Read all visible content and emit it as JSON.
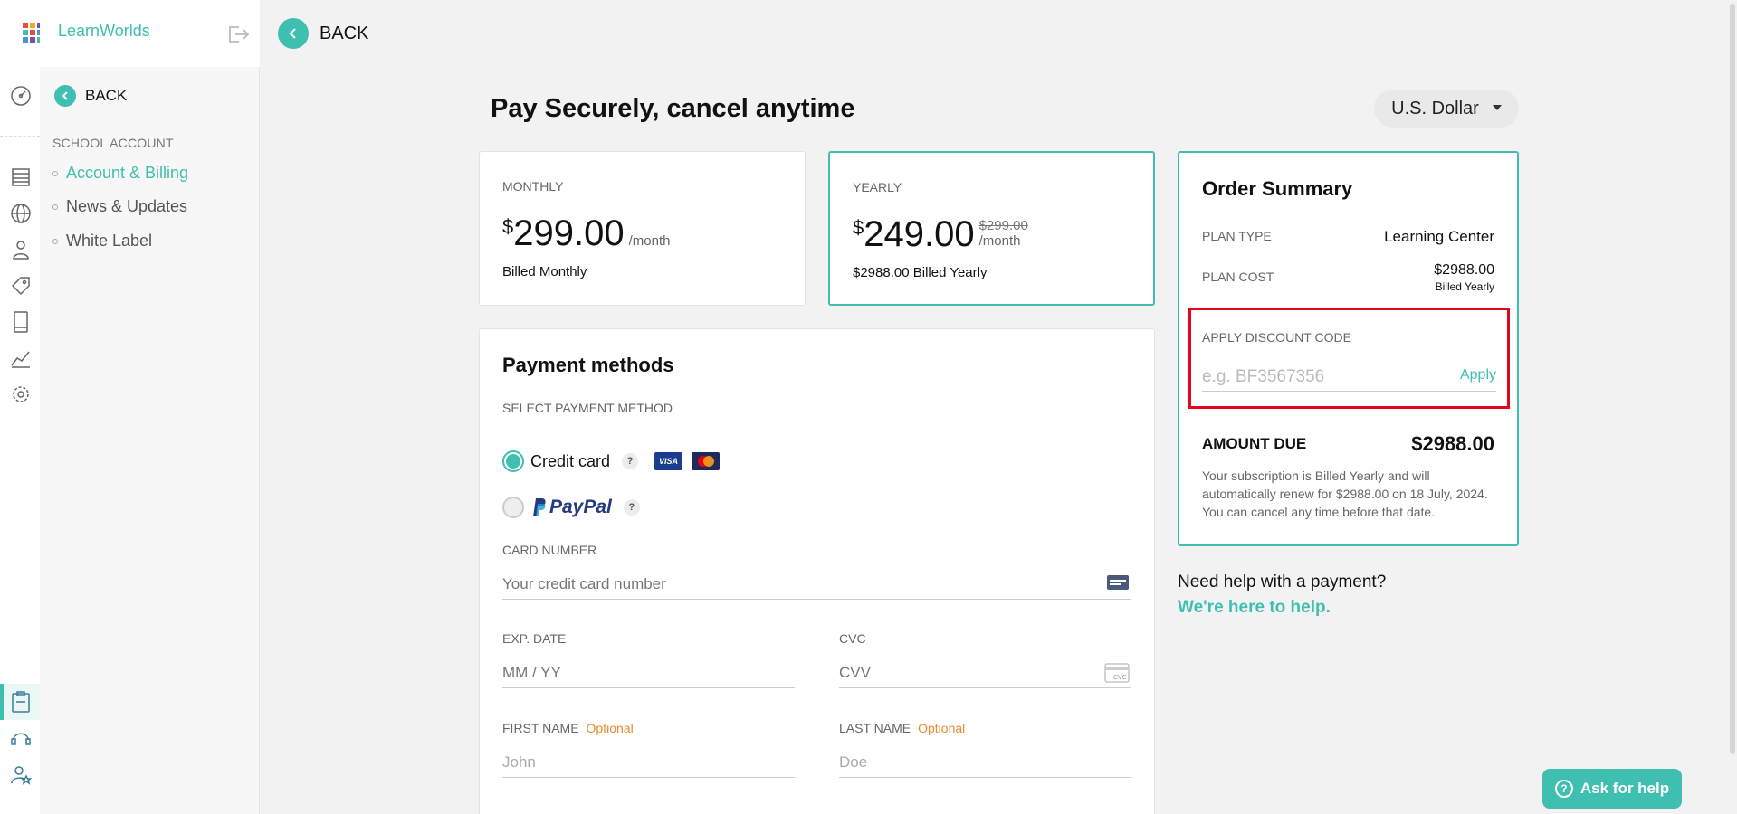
{
  "brand": {
    "name": "LearnWorlds"
  },
  "sidebar": {
    "back_label": "BACK",
    "section_label": "SCHOOL ACCOUNT",
    "items": [
      {
        "label": "Account & Billing",
        "active": true
      },
      {
        "label": "News & Updates",
        "active": false
      },
      {
        "label": "White Label",
        "active": false
      }
    ]
  },
  "header": {
    "back_label": "BACK"
  },
  "page": {
    "title": "Pay Securely, cancel anytime"
  },
  "currency": {
    "selected": "U.S. Dollar"
  },
  "plans": {
    "monthly": {
      "name": "MONTHLY",
      "symbol": "$",
      "price": "299.00",
      "per": "/month",
      "billed": "Billed Monthly"
    },
    "yearly": {
      "name": "YEARLY",
      "symbol": "$",
      "price": "249.00",
      "old_price": "$299.00",
      "per": "/month",
      "billed": "$2988.00 Billed Yearly"
    }
  },
  "payment": {
    "title": "Payment methods",
    "select_label": "SELECT PAYMENT METHOD",
    "methods": [
      {
        "label": "Credit card",
        "selected": true
      },
      {
        "label": "PayPal",
        "selected": false
      }
    ],
    "visa_label": "VISA",
    "help_glyph": "?",
    "card_number": {
      "label": "CARD NUMBER",
      "placeholder": "Your credit card number"
    },
    "exp_date": {
      "label": "EXP. DATE",
      "placeholder": "MM / YY"
    },
    "cvc": {
      "label": "CVC",
      "placeholder": "CVV",
      "icon_text": "CVC"
    },
    "first_name": {
      "label": "FIRST NAME",
      "optional": "Optional",
      "placeholder": "John"
    },
    "last_name": {
      "label": "LAST NAME",
      "optional": "Optional",
      "placeholder": "Doe"
    }
  },
  "summary": {
    "title": "Order Summary",
    "plan_type_label": "PLAN TYPE",
    "plan_type_value": "Learning Center",
    "plan_cost_label": "PLAN COST",
    "plan_cost_value": "$2988.00",
    "plan_cost_note": "Billed Yearly",
    "discount_label": "APPLY DISCOUNT CODE",
    "discount_placeholder": "e.g. BF3567356",
    "apply_label": "Apply",
    "amount_due_label": "AMOUNT DUE",
    "amount_due_value": "$2988.00",
    "renew_note": "Your subscription is Billed Yearly and will automatically renew for $2988.00 on 18 July, 2024. You can cancel any time before that date."
  },
  "help": {
    "question": "Need help with a payment?",
    "link": "We're here to help.",
    "ask_button": "Ask for help",
    "ask_glyph": "?"
  },
  "colors": {
    "accent": "#3fbfb0",
    "highlight": "#e3051b",
    "optional": "#e9892e"
  }
}
